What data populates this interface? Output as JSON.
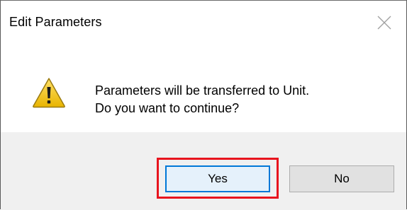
{
  "dialog": {
    "title": "Edit Parameters",
    "message_line1": "Parameters will be transferred to Unit.",
    "message_line2": "Do you want to continue?",
    "icon": "warning-icon",
    "close_icon": "close-icon"
  },
  "buttons": {
    "yes_label": "Yes",
    "no_label": "No"
  },
  "annotation": {
    "highlighted_element": "yes-button",
    "highlight_color": "#e8141e"
  },
  "colors": {
    "footer_background": "#f0f0f0",
    "focus_border": "#0078d7",
    "warning_yellow": "#f5c400"
  }
}
